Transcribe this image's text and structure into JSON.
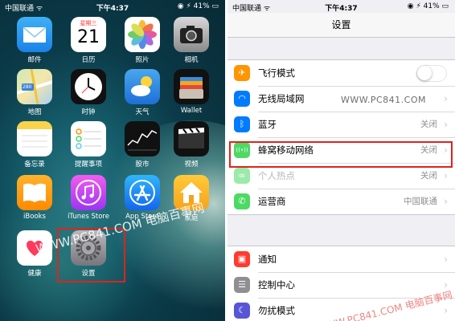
{
  "status_left": {
    "carrier": "中国联通 ᯤ",
    "time": "下午4:37",
    "battery": "◉ ⚡ 41% ▭"
  },
  "status_right": {
    "carrier": "中国联通 ᯤ",
    "time": "下午4:37",
    "battery": "◉ ⚡ 41% ▭"
  },
  "home_apps": [
    {
      "label": "邮件",
      "icon": "mail-icon"
    },
    {
      "label": "日历",
      "icon": "calendar-icon",
      "weekday": "星期三",
      "day": "21"
    },
    {
      "label": "照片",
      "icon": "photos-icon"
    },
    {
      "label": "相机",
      "icon": "camera-icon"
    },
    {
      "label": "地图",
      "icon": "maps-icon",
      "badge": "280"
    },
    {
      "label": "时钟",
      "icon": "clock-icon"
    },
    {
      "label": "天气",
      "icon": "weather-icon"
    },
    {
      "label": "Wallet",
      "icon": "wallet-icon"
    },
    {
      "label": "备忘录",
      "icon": "notes-icon"
    },
    {
      "label": "提醒事项",
      "icon": "reminders-icon"
    },
    {
      "label": "股市",
      "icon": "stocks-icon"
    },
    {
      "label": "视频",
      "icon": "videos-icon"
    },
    {
      "label": "iBooks",
      "icon": "ibooks-icon"
    },
    {
      "label": "iTunes Store",
      "icon": "itunes-icon"
    },
    {
      "label": "App Store",
      "icon": "appstore-icon"
    },
    {
      "label": "家庭",
      "icon": "home-icon"
    },
    {
      "label": "健康",
      "icon": "health-icon"
    },
    {
      "label": "设置",
      "icon": "settings-icon"
    }
  ],
  "watermark_left": "WWW.PC841.COM 电脑百事网",
  "settings": {
    "title": "设置",
    "watermark_url": "WWW.PC841.COM",
    "group1": [
      {
        "title": "飞行模式",
        "value": "",
        "icon": "airplane-icon",
        "color": "#ff9500",
        "glyph": "✈",
        "toggle": true
      },
      {
        "title": "无线局域网",
        "value": "",
        "icon": "wifi-icon",
        "color": "#007aff",
        "glyph": "◠"
      },
      {
        "title": "蓝牙",
        "value": "关闭",
        "icon": "bluetooth-icon",
        "color": "#007aff",
        "glyph": "ᛒ"
      },
      {
        "title": "蜂窝移动网络",
        "value": "关闭",
        "icon": "cellular-icon",
        "color": "#4cd964",
        "glyph": "((•))"
      },
      {
        "title": "个人热点",
        "value": "关闭",
        "icon": "hotspot-icon",
        "color": "#4cd964",
        "glyph": "∞",
        "dim": true
      },
      {
        "title": "运营商",
        "value": "中国联通",
        "icon": "carrier-icon",
        "color": "#4cd964",
        "glyph": "✆"
      }
    ],
    "group2": [
      {
        "title": "通知",
        "value": "",
        "icon": "notifications-icon",
        "color": "#ff3b30",
        "glyph": "▣"
      },
      {
        "title": "控制中心",
        "value": "",
        "icon": "control-center-icon",
        "color": "#8e8e93",
        "glyph": "☰"
      },
      {
        "title": "勿扰模式",
        "value": "",
        "icon": "do-not-disturb-icon",
        "color": "#5856d6",
        "glyph": "☾"
      }
    ]
  },
  "watermark_right": "WWW.PC841.COM 电脑百事网"
}
